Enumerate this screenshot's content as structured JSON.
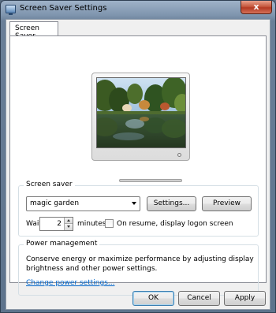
{
  "window": {
    "title": "Screen Saver Settings",
    "close_glyph": "x"
  },
  "tabs": [
    {
      "label": "Screen Saver"
    }
  ],
  "preview_icon": "monitor-preview",
  "screen_saver": {
    "group_label": "Screen saver",
    "selected": "magic garden",
    "settings_label": "Settings...",
    "preview_label": "Preview",
    "wait_label": "Wait:",
    "wait_value": "2",
    "minutes_label": "minutes",
    "resume_label": "On resume, display logon screen",
    "resume_checked": false
  },
  "power": {
    "group_label": "Power management",
    "description": "Conserve energy or maximize performance by adjusting display brightness and other power settings.",
    "link_label": "Change power settings..."
  },
  "footer": {
    "ok_label": "OK",
    "cancel_label": "Cancel",
    "apply_label": "Apply"
  },
  "colors": {
    "accent": "#3c7fb1",
    "link": "#0066cc"
  }
}
